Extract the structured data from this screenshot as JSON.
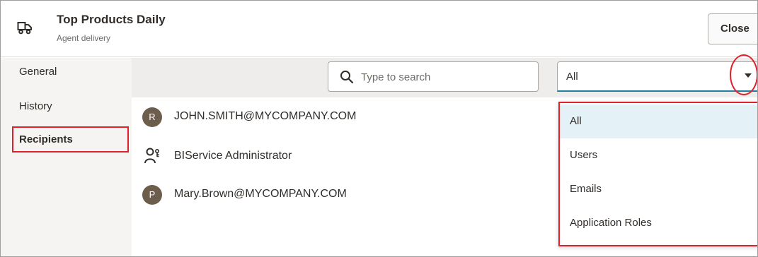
{
  "header": {
    "title": "Top Products Daily",
    "subtitle": "Agent delivery",
    "icon": "truck-icon",
    "close_label": "Close"
  },
  "nav": {
    "items": [
      {
        "label": "General",
        "active": false
      },
      {
        "label": "History",
        "active": false
      },
      {
        "label": "Recipients",
        "active": true
      }
    ]
  },
  "toolbar": {
    "search_placeholder": "Type to search",
    "search_value": "",
    "filter_value": "All"
  },
  "recipients": [
    {
      "type": "user",
      "initial": "R",
      "label": "JOHN.SMITH@MYCOMPANY.COM"
    },
    {
      "type": "role",
      "icon": "application-role-icon",
      "label": "BIService Administrator"
    },
    {
      "type": "user",
      "initial": "P",
      "label": "Mary.Brown@MYCOMPANY.COM"
    }
  ],
  "filter_options": [
    {
      "label": "All",
      "selected": true
    },
    {
      "label": "Users",
      "selected": false
    },
    {
      "label": "Emails",
      "selected": false
    },
    {
      "label": "Application Roles",
      "selected": false
    }
  ],
  "colors": {
    "highlight": "#e0202a",
    "accent": "#227e9e",
    "avatar": "#6d5d4d",
    "selected_option": "#e4f1f7"
  }
}
